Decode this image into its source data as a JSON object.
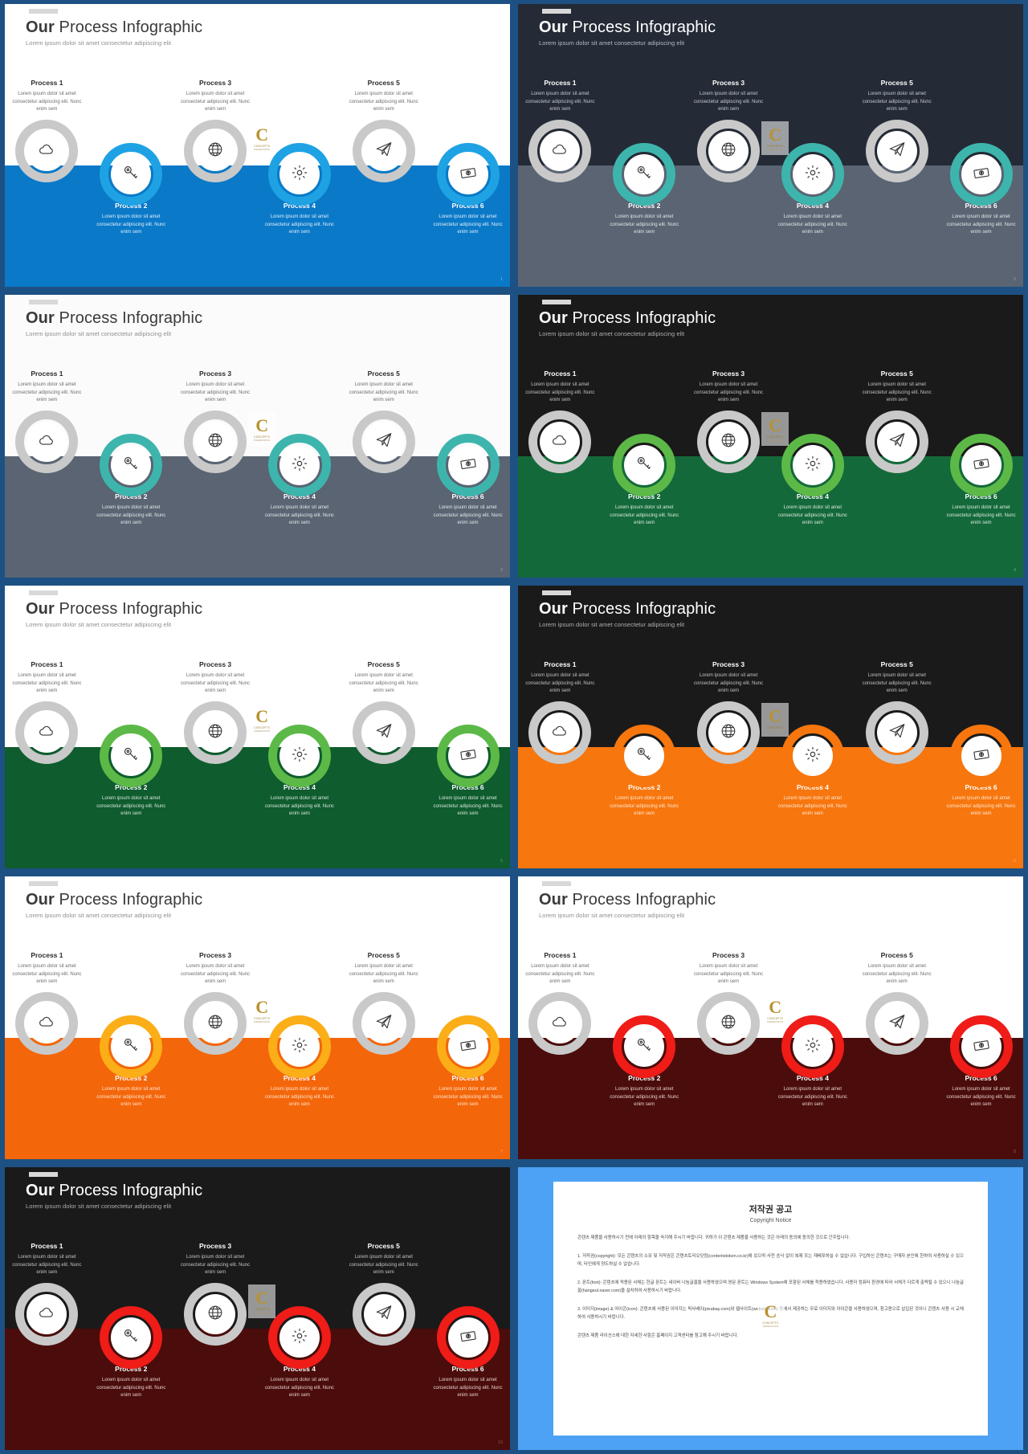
{
  "deck": {
    "title_bold": "Our",
    "title_rest": " Process Infographic",
    "subtitle": "Lorem ipsum dolor sit amet consectetur adipiscing elit",
    "process_body": "Lorem ipsum dolor sit amet consectetur adipiscing elit. Nunc enim sem",
    "top_processes": [
      "Process 1",
      "Process 3",
      "Process 5"
    ],
    "bottom_processes": [
      "Process 2",
      "Process 4",
      "Process 6"
    ],
    "icons": [
      "cloud-icon",
      "key-icon",
      "globe-icon",
      "gear-icon",
      "paper-plane-icon",
      "money-icon"
    ],
    "arc_gray": "#c9c9c9",
    "frame_color": "#1d5183"
  },
  "watermark": {
    "letter": "C",
    "name": "CONCEPTS",
    "tagline": "PRESENTATION"
  },
  "slides": [
    {
      "n": 1,
      "page": "1",
      "top_bg": "#ffffff",
      "bottom_bg": "#0a79c8",
      "accent": "#1ea2e4",
      "title_color": "#3a3a3a",
      "sub_color": "#8e8e8e",
      "top_text": "#2b2b2b",
      "top_body": "#6d6d6d",
      "bot_text": "#ffffff",
      "bot_body": "#e3eef7",
      "pg_color": "#7fb8e0"
    },
    {
      "n": 2,
      "page": "2",
      "top_bg": "#242b36",
      "bottom_bg": "#5a6472",
      "accent": "#3db5ad",
      "title_color": "#ffffff",
      "sub_color": "#b7bcc4",
      "top_text": "#ffffff",
      "top_body": "#c6cad1",
      "bot_text": "#ffffff",
      "bot_body": "#e4e7ea",
      "pg_color": "#9aa3ae"
    },
    {
      "n": 3,
      "page": "3",
      "top_bg": "#fbfbfb",
      "bottom_bg": "#5a6472",
      "accent": "#3db5ad",
      "title_color": "#3a3a3a",
      "sub_color": "#8e8e8e",
      "top_text": "#2b2b2b",
      "top_body": "#6d6d6d",
      "bot_text": "#ffffff",
      "bot_body": "#e4e7ea",
      "pg_color": "#98a1ab"
    },
    {
      "n": 4,
      "page": "4",
      "top_bg": "#1a1a1a",
      "bottom_bg": "#14693a",
      "accent": "#5cb947",
      "title_color": "#ffffff",
      "sub_color": "#b0b0b0",
      "top_text": "#ffffff",
      "top_body": "#c3c3c3",
      "bot_text": "#ffffff",
      "bot_body": "#dbe9e0",
      "pg_color": "#63a47f"
    },
    {
      "n": 5,
      "page": "5",
      "top_bg": "#ffffff",
      "bottom_bg": "#0f5c2e",
      "accent": "#5cb947",
      "title_color": "#3a3a3a",
      "sub_color": "#8e8e8e",
      "top_text": "#2b2b2b",
      "top_body": "#6d6d6d",
      "bot_text": "#ffffff",
      "bot_body": "#d7e6dd",
      "pg_color": "#5d9a77"
    },
    {
      "n": 6,
      "page": "6",
      "top_bg": "#1a1a1a",
      "bottom_bg": "#f7760d",
      "accent": "#f7760d",
      "title_color": "#ffffff",
      "sub_color": "#b0b0b0",
      "top_text": "#ffffff",
      "top_body": "#c3c3c3",
      "bot_text": "#ffffff",
      "bot_body": "#ffe9d6",
      "pg_color": "#ffb377"
    },
    {
      "n": 7,
      "page": "7",
      "top_bg": "#ffffff",
      "bottom_bg": "#f4660a",
      "accent": "#fbae17",
      "title_color": "#3a3a3a",
      "sub_color": "#8e8e8e",
      "top_text": "#2b2b2b",
      "top_body": "#6d6d6d",
      "bot_text": "#ffffff",
      "bot_body": "#ffe4cf",
      "pg_color": "#ffae74"
    },
    {
      "n": 8,
      "page": "8",
      "top_bg": "#ffffff",
      "bottom_bg": "#4a0d0b",
      "accent": "#ef1c18",
      "title_color": "#3a3a3a",
      "sub_color": "#8e8e8e",
      "top_text": "#2b2b2b",
      "top_body": "#6d6d6d",
      "bot_text": "#ffffff",
      "bot_body": "#e8cfcd",
      "pg_color": "#8c5350"
    },
    {
      "n": 9,
      "page": "10",
      "top_bg": "#1a1a1a",
      "bottom_bg": "#4a0d0b",
      "accent": "#ef1c18",
      "title_color": "#ffffff",
      "sub_color": "#b0b0b0",
      "top_text": "#ffffff",
      "top_body": "#c3c3c3",
      "bot_text": "#ffffff",
      "bot_body": "#e8cfcd",
      "pg_color": "#8c5350"
    }
  ],
  "copyright": {
    "title": "저작권 공고",
    "subtitle": "Copyright Notice",
    "intro": "콘텐츠 제품을 사용하시기 전에 아래의 항목을 숙지해 주시기 바랍니다. 귀하가 이 콘텐츠 제품을 사용하는 것은 아래의 동의에 동의한 것으로 간주됩니다.",
    "p1": "1. 저작권(copyright): 모든 콘텐츠의 소유 및 저작권은 콘텐츠토리오닷컴(contentstoken.co.kr)에 있으며 사전 승낙 없이 복제 또는 재배포하실 수 없습니다. 구입하신 콘텐츠는 구매자 본인에 한하여 사용하실 수 있으며, 타인에게 양도하실 수 없습니다.",
    "p2": "2. 폰트(font): 콘텐츠에 적용된 서체는 한글 폰트는 네이버 나눔글꼴을 사용하였으며 영문 폰트는 Windows System에 포함된 서체를 적용하였습니다. 사용자 컴퓨터 환경에 따라 서체가 다르게 출력될 수 있으니 나눔글꼴(hangeul.naver.com)을 설치하여 사용하시기 바랍니다.",
    "p3": "3. 이미지(image) & 아이콘(icon): 콘텐츠에 사용된 이미지는 픽사베이(pixabay.com)와 웹사이트(websity.com) 등에서 제공하는 무료 이미지와 아이콘을 사용하였으며, 참고용으로 삽입된 것이니 콘텐츠 사용 시 교체하여 사용하시기 바랍니다.",
    "outro": "콘텐츠 제품 라이선스에 대한 자세한 사항은 홈페이지 고객센터를 참고해 주시기 바랍니다."
  }
}
